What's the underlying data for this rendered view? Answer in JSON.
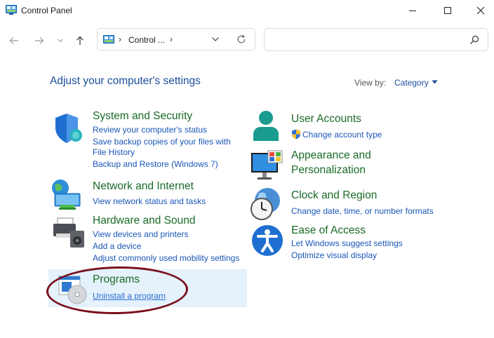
{
  "window": {
    "title": "Control Panel"
  },
  "address": {
    "path": "Control ...",
    "sep": "›"
  },
  "search": {
    "placeholder": ""
  },
  "header": {
    "title": "Adjust your computer's settings",
    "view_by_label": "View by:",
    "view_by_value": "Category"
  },
  "categories": [
    {
      "title": "System and Security",
      "links": [
        "Review your computer's status",
        "Save backup copies of your files with",
        "File History",
        "Backup and Restore (Windows 7)"
      ]
    },
    {
      "title": "Network and Internet",
      "links": [
        "View network status and tasks"
      ]
    },
    {
      "title": "Hardware and Sound",
      "links": [
        "View devices and printers",
        "Add a device",
        "Adjust commonly used mobility settings"
      ]
    },
    {
      "title": "Programs",
      "links": [
        "Uninstall a program"
      ]
    },
    {
      "title": "User Accounts",
      "links": [
        "Change account type"
      ]
    },
    {
      "title": "Appearance and",
      "title2": "Personalization",
      "links": []
    },
    {
      "title": "Clock and Region",
      "links": [
        "Change date, time, or number formats"
      ]
    },
    {
      "title": "Ease of Access",
      "links": [
        "Let Windows suggest settings",
        "Optimize visual display"
      ]
    }
  ],
  "colors": {
    "accent": "#1b4d9b",
    "category_title": "#1a6b28",
    "link": "#1a56b8",
    "highlight_bg": "#e5f1fb",
    "annotation": "#7a0f1c"
  }
}
